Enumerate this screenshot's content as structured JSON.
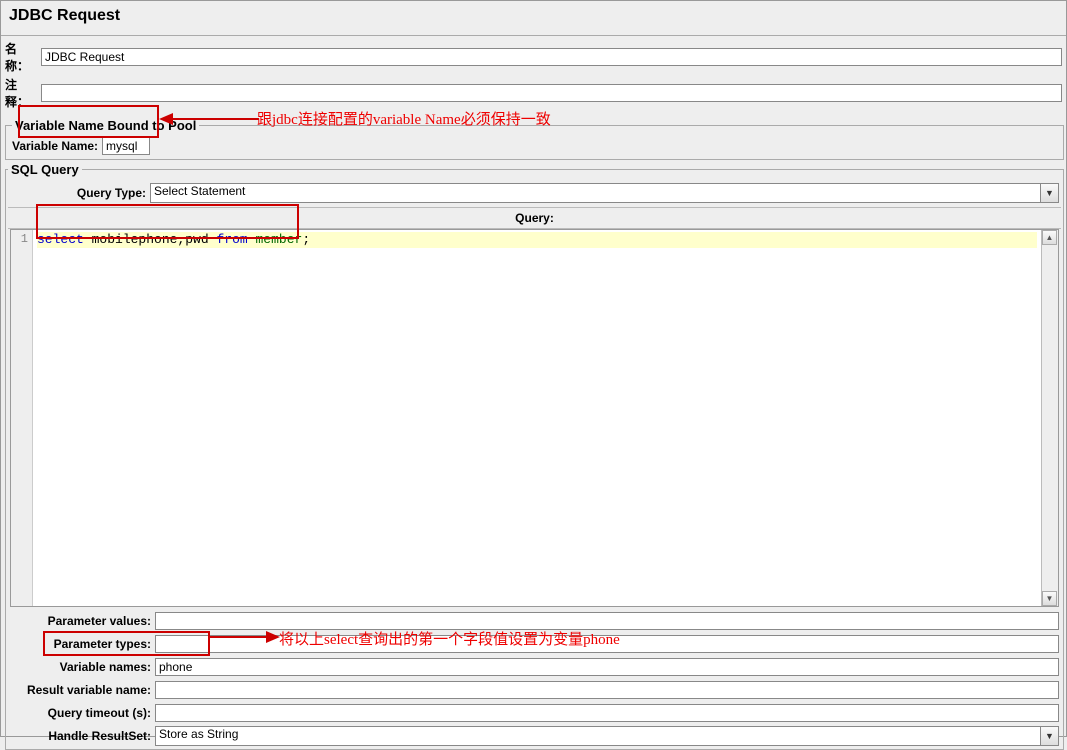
{
  "header": {
    "title": "JDBC Request"
  },
  "fields": {
    "name_label": "名称：",
    "name_value": "JDBC Request",
    "comment_label": "注释：",
    "comment_value": ""
  },
  "pool_section": {
    "legend": "Variable Name Bound to Pool",
    "var_name_label": "Variable Name:",
    "var_name_value": "mysql"
  },
  "sql_section": {
    "legend": "SQL Query",
    "query_type_label": "Query Type:",
    "query_type_value": "Select Statement",
    "query_header": "Query:",
    "code": {
      "line_no": "1",
      "kw1": "select",
      "cols": "mobilephone,pwd",
      "kw2": "from",
      "table": "member",
      "semi": ";"
    }
  },
  "bottom": {
    "param_values_label": "Parameter values:",
    "param_values": "",
    "param_types_label": "Parameter types:",
    "param_types": "",
    "var_names_label": "Variable names:",
    "var_names": "phone",
    "result_var_label": "Result variable name:",
    "result_var": "",
    "timeout_label": "Query timeout (s):",
    "timeout": "",
    "handle_rs_label": "Handle ResultSet:",
    "handle_rs_value": "Store as String"
  },
  "annotations": {
    "a1": "跟jdbc连接配置的variable Name必须保持一致",
    "a2": "将以上select查询出的第一个字段值设置为变量phone"
  }
}
